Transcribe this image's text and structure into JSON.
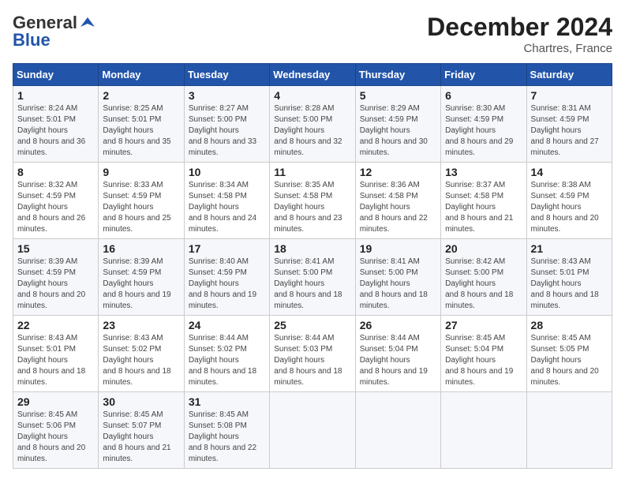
{
  "header": {
    "logo_general": "General",
    "logo_blue": "Blue",
    "month_year": "December 2024",
    "location": "Chartres, France"
  },
  "weekdays": [
    "Sunday",
    "Monday",
    "Tuesday",
    "Wednesday",
    "Thursday",
    "Friday",
    "Saturday"
  ],
  "weeks": [
    [
      {
        "day": "1",
        "sunrise": "8:24 AM",
        "sunset": "5:01 PM",
        "daylight": "8 hours and 36 minutes."
      },
      {
        "day": "2",
        "sunrise": "8:25 AM",
        "sunset": "5:01 PM",
        "daylight": "8 hours and 35 minutes."
      },
      {
        "day": "3",
        "sunrise": "8:27 AM",
        "sunset": "5:00 PM",
        "daylight": "8 hours and 33 minutes."
      },
      {
        "day": "4",
        "sunrise": "8:28 AM",
        "sunset": "5:00 PM",
        "daylight": "8 hours and 32 minutes."
      },
      {
        "day": "5",
        "sunrise": "8:29 AM",
        "sunset": "4:59 PM",
        "daylight": "8 hours and 30 minutes."
      },
      {
        "day": "6",
        "sunrise": "8:30 AM",
        "sunset": "4:59 PM",
        "daylight": "8 hours and 29 minutes."
      },
      {
        "day": "7",
        "sunrise": "8:31 AM",
        "sunset": "4:59 PM",
        "daylight": "8 hours and 27 minutes."
      }
    ],
    [
      {
        "day": "8",
        "sunrise": "8:32 AM",
        "sunset": "4:59 PM",
        "daylight": "8 hours and 26 minutes."
      },
      {
        "day": "9",
        "sunrise": "8:33 AM",
        "sunset": "4:59 PM",
        "daylight": "8 hours and 25 minutes."
      },
      {
        "day": "10",
        "sunrise": "8:34 AM",
        "sunset": "4:58 PM",
        "daylight": "8 hours and 24 minutes."
      },
      {
        "day": "11",
        "sunrise": "8:35 AM",
        "sunset": "4:58 PM",
        "daylight": "8 hours and 23 minutes."
      },
      {
        "day": "12",
        "sunrise": "8:36 AM",
        "sunset": "4:58 PM",
        "daylight": "8 hours and 22 minutes."
      },
      {
        "day": "13",
        "sunrise": "8:37 AM",
        "sunset": "4:58 PM",
        "daylight": "8 hours and 21 minutes."
      },
      {
        "day": "14",
        "sunrise": "8:38 AM",
        "sunset": "4:59 PM",
        "daylight": "8 hours and 20 minutes."
      }
    ],
    [
      {
        "day": "15",
        "sunrise": "8:39 AM",
        "sunset": "4:59 PM",
        "daylight": "8 hours and 20 minutes."
      },
      {
        "day": "16",
        "sunrise": "8:39 AM",
        "sunset": "4:59 PM",
        "daylight": "8 hours and 19 minutes."
      },
      {
        "day": "17",
        "sunrise": "8:40 AM",
        "sunset": "4:59 PM",
        "daylight": "8 hours and 19 minutes."
      },
      {
        "day": "18",
        "sunrise": "8:41 AM",
        "sunset": "5:00 PM",
        "daylight": "8 hours and 18 minutes."
      },
      {
        "day": "19",
        "sunrise": "8:41 AM",
        "sunset": "5:00 PM",
        "daylight": "8 hours and 18 minutes."
      },
      {
        "day": "20",
        "sunrise": "8:42 AM",
        "sunset": "5:00 PM",
        "daylight": "8 hours and 18 minutes."
      },
      {
        "day": "21",
        "sunrise": "8:43 AM",
        "sunset": "5:01 PM",
        "daylight": "8 hours and 18 minutes."
      }
    ],
    [
      {
        "day": "22",
        "sunrise": "8:43 AM",
        "sunset": "5:01 PM",
        "daylight": "8 hours and 18 minutes."
      },
      {
        "day": "23",
        "sunrise": "8:43 AM",
        "sunset": "5:02 PM",
        "daylight": "8 hours and 18 minutes."
      },
      {
        "day": "24",
        "sunrise": "8:44 AM",
        "sunset": "5:02 PM",
        "daylight": "8 hours and 18 minutes."
      },
      {
        "day": "25",
        "sunrise": "8:44 AM",
        "sunset": "5:03 PM",
        "daylight": "8 hours and 18 minutes."
      },
      {
        "day": "26",
        "sunrise": "8:44 AM",
        "sunset": "5:04 PM",
        "daylight": "8 hours and 19 minutes."
      },
      {
        "day": "27",
        "sunrise": "8:45 AM",
        "sunset": "5:04 PM",
        "daylight": "8 hours and 19 minutes."
      },
      {
        "day": "28",
        "sunrise": "8:45 AM",
        "sunset": "5:05 PM",
        "daylight": "8 hours and 20 minutes."
      }
    ],
    [
      {
        "day": "29",
        "sunrise": "8:45 AM",
        "sunset": "5:06 PM",
        "daylight": "8 hours and 20 minutes."
      },
      {
        "day": "30",
        "sunrise": "8:45 AM",
        "sunset": "5:07 PM",
        "daylight": "8 hours and 21 minutes."
      },
      {
        "day": "31",
        "sunrise": "8:45 AM",
        "sunset": "5:08 PM",
        "daylight": "8 hours and 22 minutes."
      },
      null,
      null,
      null,
      null
    ]
  ]
}
